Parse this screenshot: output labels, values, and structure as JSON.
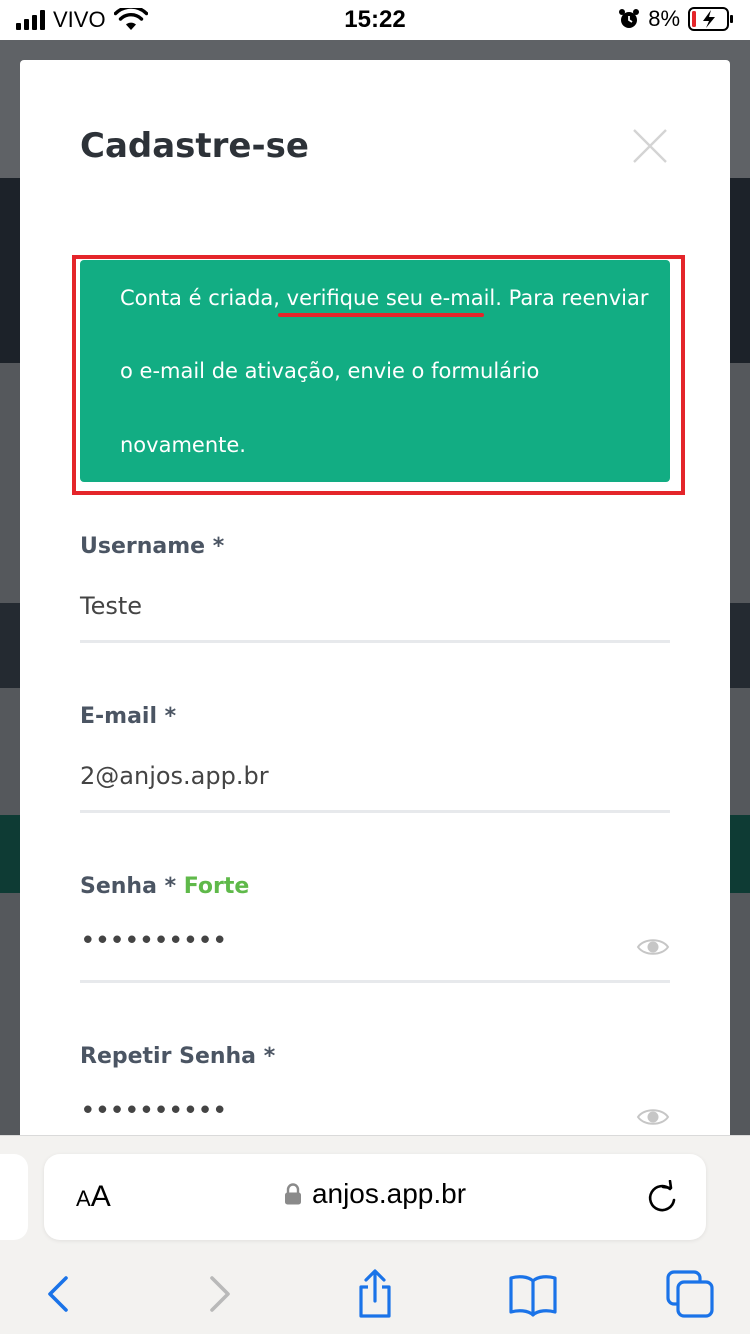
{
  "status_bar": {
    "carrier": "VIVO",
    "time": "15:22",
    "battery": "8%"
  },
  "modal": {
    "title": "Cadastre-se",
    "alert": {
      "line1_a": "Conta é criada, ",
      "line1_b": "verifique seu e-mail",
      "line1_c": ". Para reenviar",
      "line2": "o e-mail de ativação, envie o formulário",
      "line3": "novamente."
    },
    "fields": [
      {
        "label": "Username *",
        "value": "Teste"
      },
      {
        "label": "E-mail *",
        "value": "2@anjos.app.br"
      },
      {
        "label": "Senha *",
        "strength": "Forte",
        "value": "••••••••••"
      },
      {
        "label": "Repetir Senha *",
        "value": "••••••••••"
      }
    ]
  },
  "browser": {
    "text_size_a": "A",
    "text_size_b": "A",
    "url": "anjos.app.br"
  },
  "icons": {
    "close": "close-icon",
    "eye": "eye-icon",
    "lock": "lock-icon",
    "reload": "reload-icon",
    "back": "chevron-left-icon",
    "forward": "chevron-right-icon",
    "share": "share-icon",
    "bookmarks": "book-icon",
    "tabs": "tabs-icon"
  },
  "colors": {
    "alert_bg": "#12ad83",
    "highlight": "#e4252a",
    "strength": "#5fb94a",
    "ios_blue": "#1a73e8"
  }
}
